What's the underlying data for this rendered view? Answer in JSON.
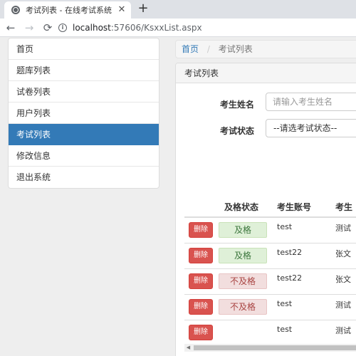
{
  "browser": {
    "tab_title": "考试列表 - 在线考试系统",
    "tab_close": "✕",
    "new_tab": "+",
    "back": "←",
    "forward": "→",
    "reload": "⟳",
    "url_host": "localhost",
    "url_path": ":57606/KsxxList.aspx"
  },
  "sidebar": {
    "items": [
      {
        "label": "首页"
      },
      {
        "label": "题库列表"
      },
      {
        "label": "试卷列表"
      },
      {
        "label": "用户列表"
      },
      {
        "label": "考试列表",
        "active": true
      },
      {
        "label": "修改信息"
      },
      {
        "label": "退出系统"
      }
    ]
  },
  "breadcrumb": {
    "home": "首页",
    "separator": "/",
    "current": "考试列表"
  },
  "panel": {
    "title": "考试列表"
  },
  "search": {
    "name_label": "考生姓名",
    "name_placeholder": "请输入考生姓名",
    "status_label": "考试状态",
    "status_selected": "--请选考试状态--"
  },
  "table": {
    "headers": {
      "status": "及格状态",
      "account": "考生账号",
      "name": "考生"
    },
    "rows": [
      {
        "action": "删除",
        "status": "及格",
        "account": "test",
        "name": "测试"
      },
      {
        "action": "删除",
        "status": "及格",
        "account": "test22",
        "name": "张文"
      },
      {
        "action": "删除",
        "status": "不及格",
        "account": "test22",
        "name": "张文"
      },
      {
        "action": "删除",
        "status": "不及格",
        "account": "test",
        "name": "测试"
      },
      {
        "action": "删除",
        "status": "",
        "account": "test",
        "name": "测试"
      }
    ]
  },
  "colors": {
    "primary": "#337ab7",
    "danger": "#d9534f",
    "success_bg": "#dff0d8",
    "fail_bg": "#f2dede"
  },
  "icons": {
    "favicon": "globe-icon",
    "site_info": "info-icon",
    "scroll_left": "arrow-left-icon"
  }
}
